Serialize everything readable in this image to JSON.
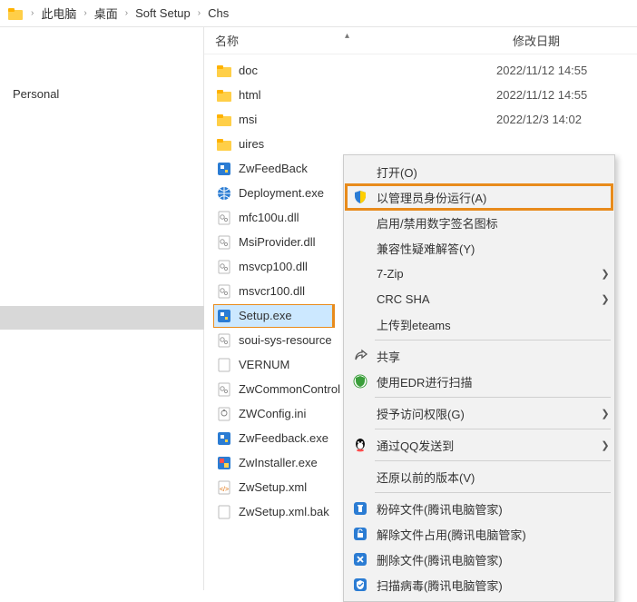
{
  "breadcrumb": [
    "此电脑",
    "桌面",
    "Soft Setup",
    "Chs"
  ],
  "sidebar": {
    "item": "Personal"
  },
  "columns": {
    "name": "名称",
    "date": "修改日期"
  },
  "files": [
    {
      "icon": "folder",
      "name": "doc",
      "date": "2022/11/12 14:55"
    },
    {
      "icon": "folder",
      "name": "html",
      "date": "2022/11/12 14:55"
    },
    {
      "icon": "folder",
      "name": "msi",
      "date": "2022/12/3 14:02"
    },
    {
      "icon": "folder",
      "name": "uires",
      "date": ""
    },
    {
      "icon": "exe-blue",
      "name": "ZwFeedBack",
      "date": ""
    },
    {
      "icon": "globe",
      "name": "Deployment.exe",
      "date": ""
    },
    {
      "icon": "dll",
      "name": "mfc100u.dll",
      "date": ""
    },
    {
      "icon": "dll",
      "name": "MsiProvider.dll",
      "date": ""
    },
    {
      "icon": "dll",
      "name": "msvcp100.dll",
      "date": ""
    },
    {
      "icon": "dll",
      "name": "msvcr100.dll",
      "date": ""
    },
    {
      "icon": "exe-blue",
      "name": "Setup.exe",
      "date": "",
      "selected": true
    },
    {
      "icon": "dll",
      "name": "soui-sys-resource",
      "date": ""
    },
    {
      "icon": "file",
      "name": "VERNUM",
      "date": ""
    },
    {
      "icon": "dll",
      "name": "ZwCommonControl",
      "date": ""
    },
    {
      "icon": "ini",
      "name": "ZWConfig.ini",
      "date": ""
    },
    {
      "icon": "exe-blue",
      "name": "ZwFeedback.exe",
      "date": ""
    },
    {
      "icon": "exe-multi",
      "name": "ZwInstaller.exe",
      "date": ""
    },
    {
      "icon": "xml",
      "name": "ZwSetup.xml",
      "date": ""
    },
    {
      "icon": "file",
      "name": "ZwSetup.xml.bak",
      "date": ""
    }
  ],
  "context_menu": [
    {
      "label": "打开(O)",
      "icon": ""
    },
    {
      "label": "以管理员身份运行(A)",
      "icon": "shield",
      "highlight": true
    },
    {
      "label": "启用/禁用数字签名图标",
      "icon": ""
    },
    {
      "label": "兼容性疑难解答(Y)",
      "icon": ""
    },
    {
      "label": "7-Zip",
      "icon": "",
      "submenu": true
    },
    {
      "label": "CRC SHA",
      "icon": "",
      "submenu": true
    },
    {
      "label": "上传到eteams",
      "icon": ""
    },
    {
      "sep": true
    },
    {
      "label": "共享",
      "icon": "share"
    },
    {
      "label": "使用EDR进行扫描",
      "icon": "edr"
    },
    {
      "sep": true
    },
    {
      "label": "授予访问权限(G)",
      "icon": "",
      "submenu": true
    },
    {
      "sep": true
    },
    {
      "label": "通过QQ发送到",
      "icon": "qq",
      "submenu": true
    },
    {
      "sep": true
    },
    {
      "label": "还原以前的版本(V)",
      "icon": ""
    },
    {
      "sep": true
    },
    {
      "label": "粉碎文件(腾讯电脑管家)",
      "icon": "tm-blue"
    },
    {
      "label": "解除文件占用(腾讯电脑管家)",
      "icon": "tm-unlock"
    },
    {
      "label": "删除文件(腾讯电脑管家)",
      "icon": "tm-del"
    },
    {
      "label": "扫描病毒(腾讯电脑管家)",
      "icon": "tm-scan"
    }
  ]
}
